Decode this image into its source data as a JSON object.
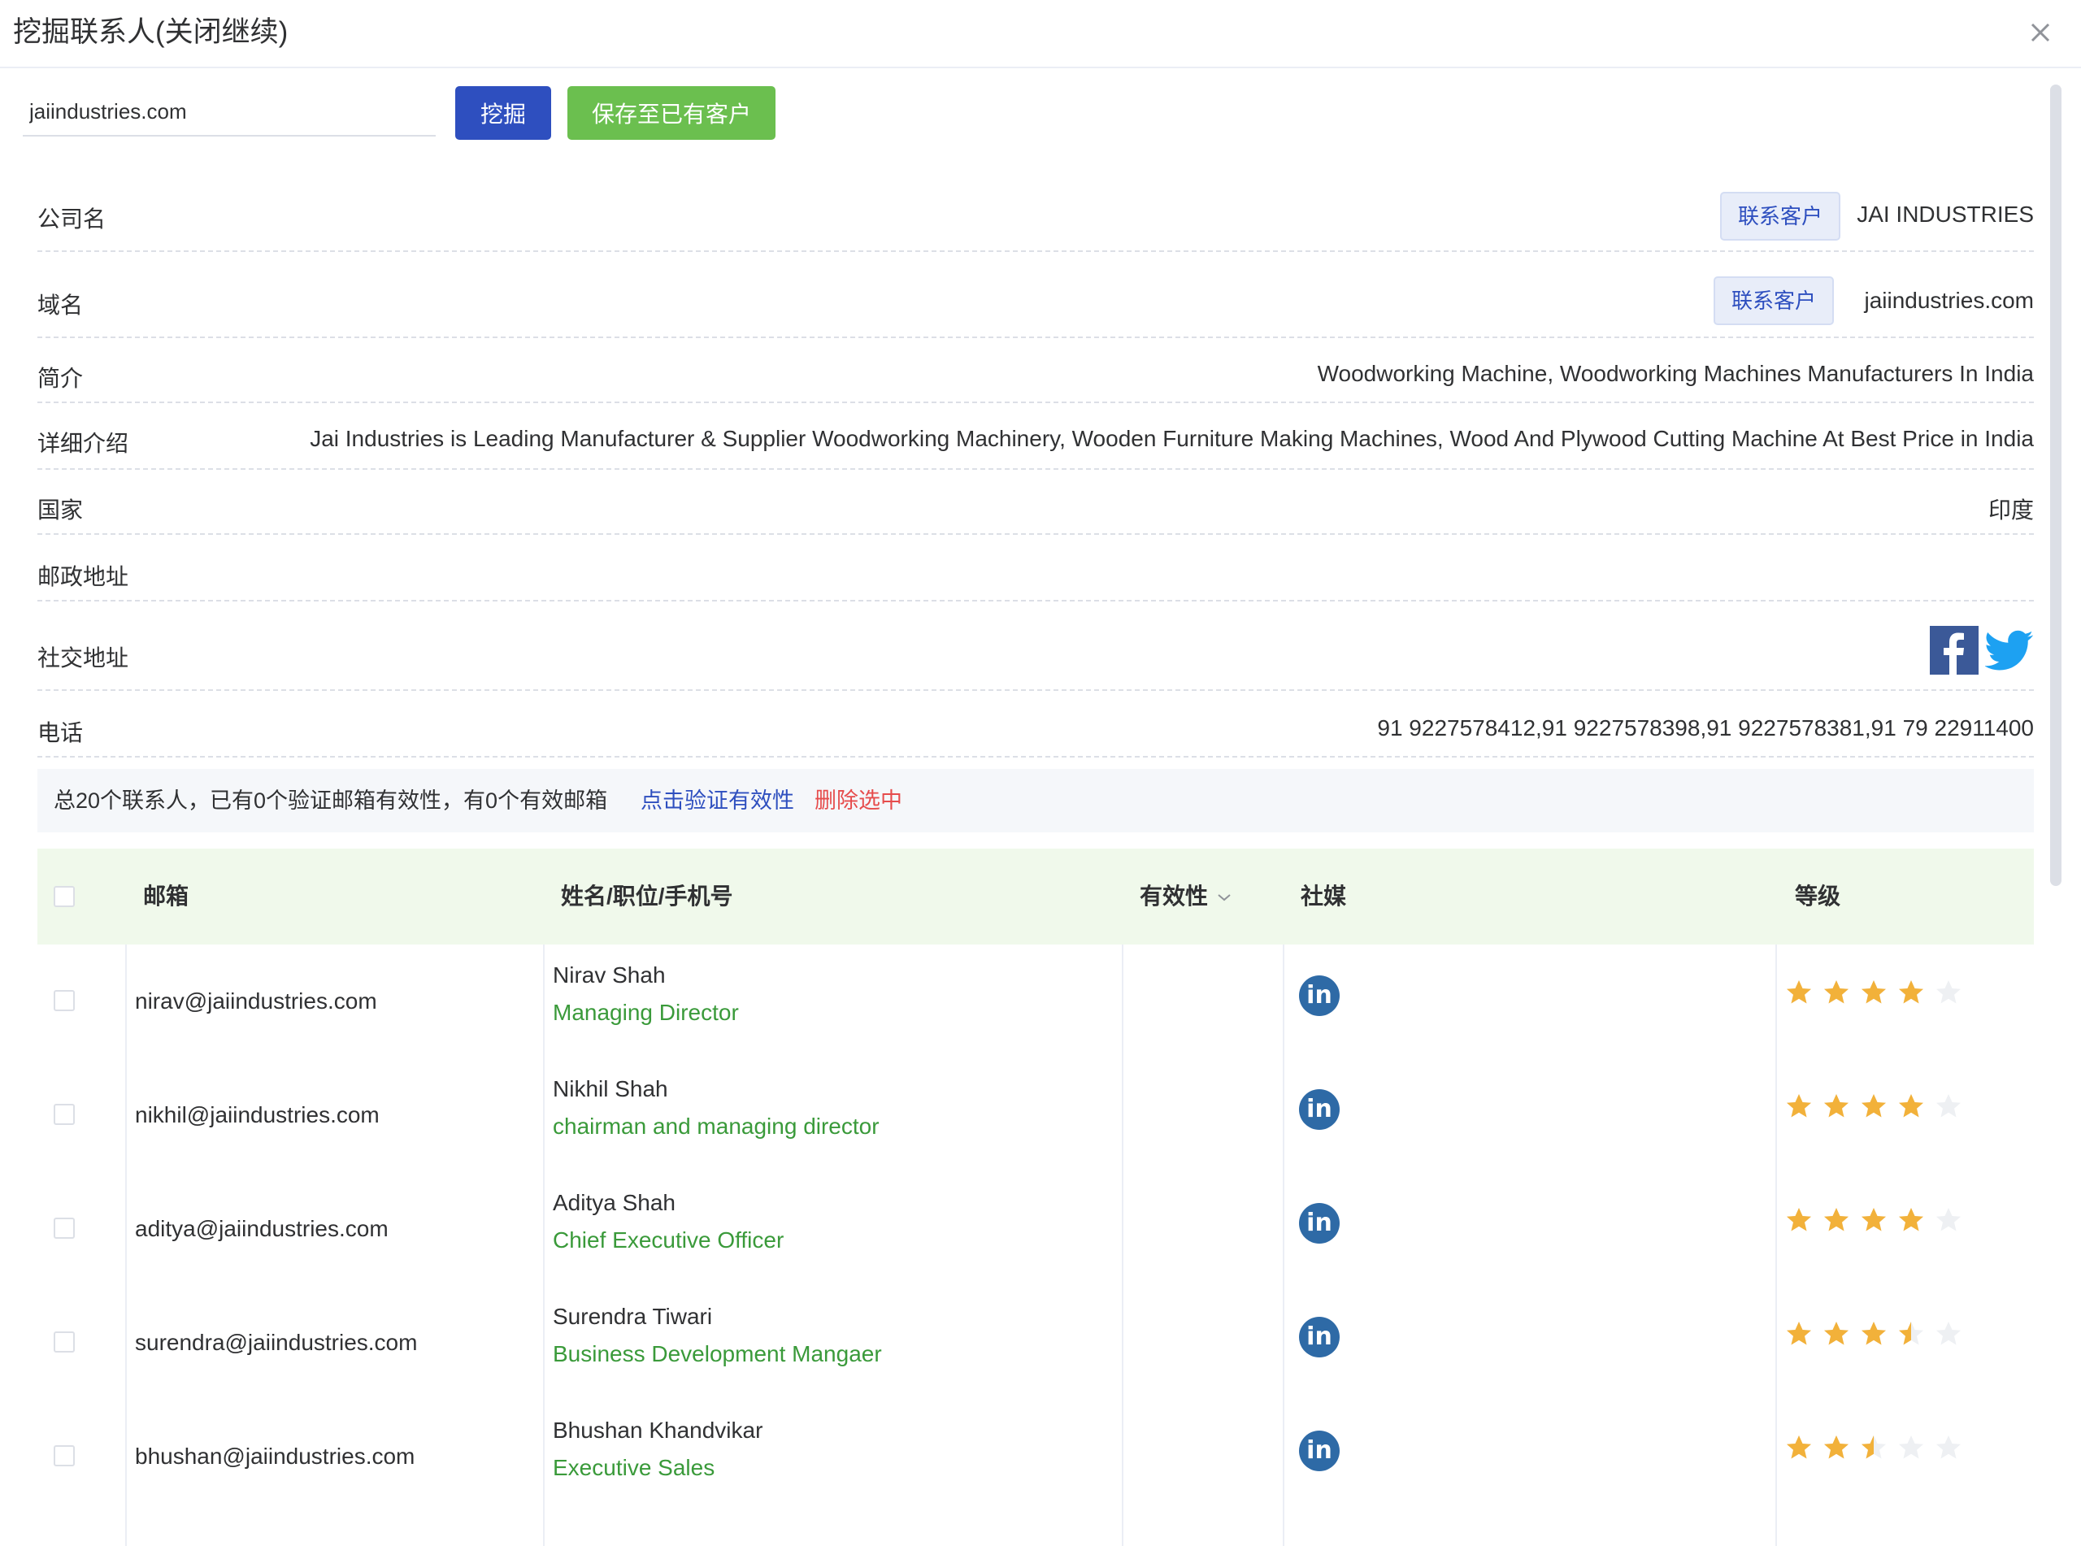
{
  "dialog": {
    "title": "挖掘联系人(关闭继续)"
  },
  "search": {
    "value": "jaiindustries.com",
    "dig_label": "挖掘",
    "save_label": "保存至已有客户"
  },
  "company": {
    "name_label": "公司名",
    "name_link": "联系客户",
    "name_value": "JAI INDUSTRIES",
    "domain_label": "域名",
    "domain_link": "联系客户",
    "domain_value": "jaiindustries.com",
    "intro_label": "简介",
    "intro_value": "Woodworking Machine, Woodworking Machines Manufacturers In India",
    "detail_label": "详细介绍",
    "detail_value": "Jai Industries is Leading Manufacturer & Supplier Woodworking Machinery, Wooden Furniture Making Machines, Wood And Plywood Cutting Machine At Best Price in India",
    "country_label": "国家",
    "country_value": "印度",
    "postal_label": "邮政地址",
    "postal_value": "",
    "social_label": "社交地址",
    "phone_label": "电话",
    "phone_value": "91 9227578412,91 9227578398,91 9227578381,91 79 22911400"
  },
  "summary": {
    "text": "总20个联系人，已有0个验证邮箱有效性，有0个有效邮箱",
    "verify_link": "点击验证有效性",
    "delete_link": "删除选中"
  },
  "table": {
    "headers": {
      "email": "邮箱",
      "name": "姓名/职位/手机号",
      "validity": "有效性",
      "social": "社媒",
      "level": "等级"
    },
    "rows": [
      {
        "email": "nirav@jaiindustries.com",
        "name": "Nirav Shah",
        "title": "Managing Director",
        "stars": 4
      },
      {
        "email": "nikhil@jaiindustries.com",
        "name": "Nikhil Shah",
        "title": "chairman and managing director",
        "stars": 4
      },
      {
        "email": "aditya@jaiindustries.com",
        "name": "Aditya Shah",
        "title": "Chief Executive Officer",
        "stars": 4
      },
      {
        "email": "surendra@jaiindustries.com",
        "name": "Surendra Tiwari",
        "title": "Business Development Mangaer",
        "stars": 3.5
      },
      {
        "email": "bhushan@jaiindustries.com",
        "name": "Bhushan Khandvikar",
        "title": "Executive Sales",
        "stars": 2.5
      }
    ]
  },
  "colors": {
    "primary": "#2e4fbf",
    "success": "#6bbf4f",
    "danger": "#e64c4c",
    "title_green": "#3a9a3a",
    "star": "#f2b13a",
    "linkedin": "#2e6aa6"
  },
  "icons": {
    "close": "close-icon",
    "facebook": "facebook-icon",
    "twitter": "twitter-icon",
    "linkedin": "linkedin-icon",
    "star": "star-icon",
    "sort": "chevron-down-icon"
  }
}
